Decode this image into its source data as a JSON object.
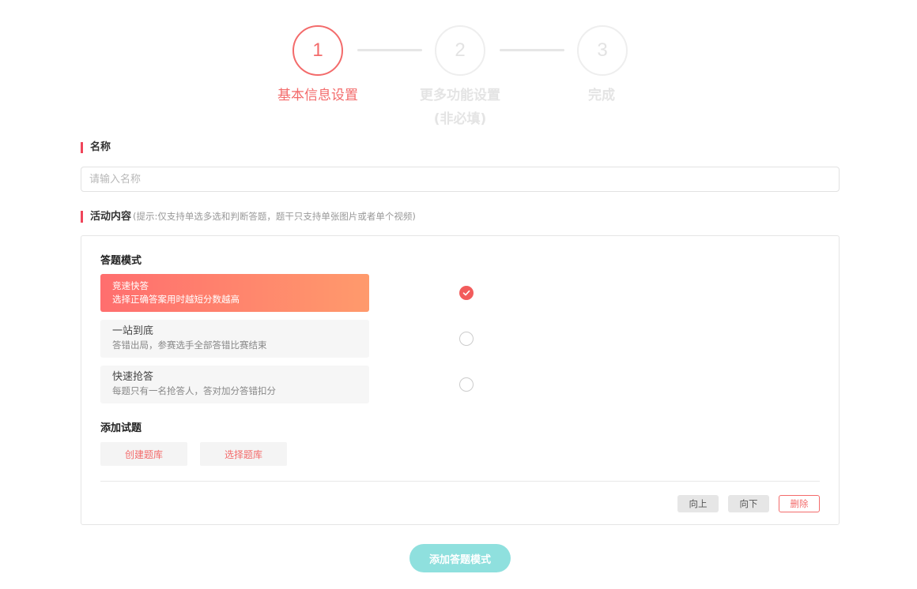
{
  "stepper": {
    "steps": [
      {
        "number": "1",
        "label": "基本信息设置",
        "sublabel": ""
      },
      {
        "number": "2",
        "label": "更多功能设置",
        "sublabel": "(非必填)"
      },
      {
        "number": "3",
        "label": "完成",
        "sublabel": ""
      }
    ],
    "active_index": 0
  },
  "name_section": {
    "title": "名称",
    "placeholder": "请输入名称",
    "value": ""
  },
  "content_section": {
    "title": "活动内容",
    "hint": "(提示:仅支持单选多选和判断答题，题干只支持单张图片或者单个视频)",
    "mode_label": "答题模式",
    "modes": [
      {
        "title": "竞速快答",
        "desc": "选择正确答案用时越短分数越高",
        "selected": true
      },
      {
        "title": "一站到底",
        "desc": "答错出局，参赛选手全部答错比赛结束",
        "selected": false
      },
      {
        "title": "快速抢答",
        "desc": "每题只有一名抢答人，答对加分答错扣分",
        "selected": false
      }
    ],
    "add_questions_label": "添加试题",
    "create_bank_label": "创建题库",
    "select_bank_label": "选择题库",
    "up_label": "向上",
    "down_label": "向下",
    "delete_label": "删除"
  },
  "add_mode_button": "添加答题模式",
  "colors": {
    "accent": "#f36b6b",
    "section_bar": "#f0455a",
    "add_button": "#8fe0de"
  }
}
